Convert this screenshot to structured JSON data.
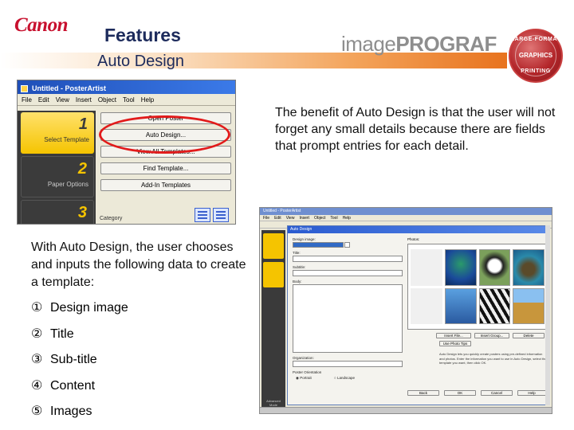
{
  "header": {
    "brand": "Canon",
    "section": "Features",
    "subtitle": "Auto Design",
    "product_logo_light": "image",
    "product_logo_bold": "PROGRAF",
    "badge": {
      "top": "LARGE-FORMAT",
      "middle": "GRAPHICS",
      "bottom": "PRINTING"
    }
  },
  "screenshot1": {
    "window_title": "Untitled - PosterArtist",
    "menu": [
      "File",
      "Edit",
      "View",
      "Insert",
      "Object",
      "Tool",
      "Help"
    ],
    "steps": [
      {
        "number": "1",
        "label": "Select Template"
      },
      {
        "number": "2",
        "label": "Paper Options"
      },
      {
        "number": "3",
        "label": ""
      }
    ],
    "buttons": [
      "Open Poster",
      "Auto Design...",
      "View All Templates...",
      "Find Template...",
      "Add-In Templates"
    ],
    "category_label": "Category",
    "highlighted_button": "Auto Design..."
  },
  "benefit_text": "The benefit of Auto Design is that the user will not forget any small details because there are fields that prompt entries for each detail.",
  "intro_text": "With Auto Design, the user chooses and inputs the following data to create a template:",
  "data_items": [
    {
      "marker": "①",
      "label": "Design image"
    },
    {
      "marker": "②",
      "label": "Title"
    },
    {
      "marker": "③",
      "label": "Sub-title"
    },
    {
      "marker": "④",
      "label": "Content"
    },
    {
      "marker": "⑤",
      "label": "Images"
    }
  ],
  "screenshot2": {
    "window_title": "Untitled - PosterArtist",
    "menu": [
      "File",
      "Edit",
      "View",
      "Insert",
      "Object",
      "Tool",
      "Help"
    ],
    "dialog_title": "Auto Design",
    "fields": [
      "Design image:",
      "Title:",
      "Subtitle:",
      "Body:",
      "Organization:"
    ],
    "photos_label": "Photos:",
    "photo_subjects": [
      "peacock",
      "panda",
      "sea-turtle",
      "dolphin",
      "zebra",
      "giraffe"
    ],
    "photo_buttons": [
      "Insert File...",
      "Insert Group...",
      "Delete"
    ],
    "photo_link": "Use Photo Tips",
    "poster_orientation_label": "Poster Orientation",
    "orientation_options": [
      "Portrait",
      "Landscape"
    ],
    "description": "Auto Design lets you quickly create posters using pre-defined information and photos. Enter the information you want to use in Auto Design, select the template you want, then click OK.",
    "action_buttons": [
      "Back",
      "OK",
      "Cancel",
      "Help"
    ],
    "left_note": "Advanced Mode",
    "accent_color": "#316ac5",
    "step_color": "#f5c400"
  }
}
